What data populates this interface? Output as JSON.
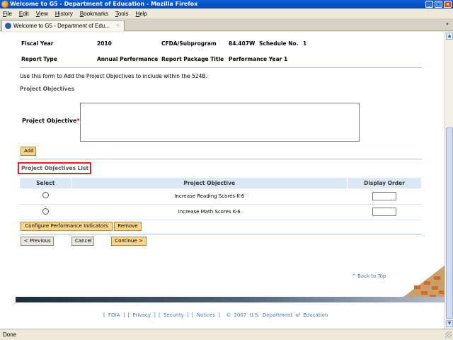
{
  "window": {
    "title": "Welcome to G5 - Department of Education - Mozilla Firefox",
    "controls": [
      "_",
      "□",
      "×"
    ]
  },
  "menu": [
    "File",
    "Edit",
    "View",
    "History",
    "Bookmarks",
    "Tools",
    "Help"
  ],
  "tab": {
    "title": "Welcome to G5 - Department of Edu...",
    "close": "÷",
    "list_all": "▾"
  },
  "info": {
    "fiscal_year_label": "Fiscal Year",
    "fiscal_year_value": "2010",
    "cfda_label": "CFDA/Subprogram",
    "cfda_value": "84.407W",
    "schedule_label": "Schedule No.",
    "schedule_value": "1",
    "report_type_label": "Report Type",
    "report_type_value": "Annual Performance",
    "package_title_label": "Report Package Title",
    "package_title_value": "Performance Year 1"
  },
  "form": {
    "instructions": "Use this form to Add the Project Objectives to include within the 524B.",
    "section_label": "Project Objectives",
    "objective_label": "Project Objective",
    "required_marker": "*",
    "objective_value": "",
    "add_label": "Add"
  },
  "list": {
    "title": "Project Objectives List",
    "headers": {
      "select": "Select",
      "objective": "Project Objective",
      "order": "Display Order"
    },
    "rows": [
      {
        "objective": "Increase Reading Scores K-6",
        "order": ""
      },
      {
        "objective": "Increase Math Scores K-6",
        "order": ""
      }
    ],
    "configure_label": "Configure Performance Indicators",
    "remove_label": "Remove"
  },
  "nav": {
    "previous_label": "< Previous",
    "cancel_label": "Cancel",
    "continue_label": "Continue >"
  },
  "back_to_top": "^ Back to Top",
  "footer": {
    "foia": "FOIA",
    "privacy": "Privacy",
    "security": "Security",
    "notices": "Notices",
    "copyright": "© 2007 U.S. Department of Education"
  },
  "status": "Done",
  "colors": {
    "accent_button": "#fbd38a",
    "link": "#4476c0",
    "highlight_box": "#d9232d",
    "table_header": "#dce8f6"
  }
}
